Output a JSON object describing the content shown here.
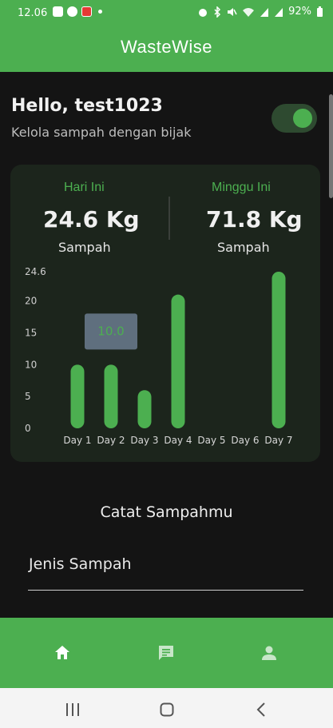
{
  "status_bar": {
    "time": "12.06",
    "battery": "92%",
    "left_icons": [
      "image-icon",
      "whatsapp-icon",
      "app-notification-icon",
      "dot-icon"
    ],
    "right_icons": [
      "alarm-icon",
      "bluetooth-icon",
      "mute-icon",
      "wifi-icon",
      "signal-icon",
      "signal-icon",
      "battery-icon"
    ]
  },
  "app_bar": {
    "title": "WasteWise"
  },
  "greeting": {
    "title": "Hello, test1023",
    "subtitle": "Kelola sampah dengan bijak",
    "theme_toggle_on": true
  },
  "stats": {
    "today": {
      "label": "Hari Ini",
      "value": "24.6 Kg",
      "unit": "Sampah"
    },
    "week": {
      "label": "Minggu Ini",
      "value": "71.8 Kg",
      "unit": "Sampah"
    }
  },
  "chart_data": {
    "type": "bar",
    "categories": [
      "Day 1",
      "Day 2",
      "Day 3",
      "Day 4",
      "Day 5",
      "Day 6",
      "Day 7"
    ],
    "values": [
      10,
      10,
      6,
      21,
      0,
      0,
      24.6
    ],
    "ylim": [
      0,
      24.6
    ],
    "yticks": [
      "0",
      "5",
      "10",
      "15",
      "20",
      "24.6"
    ],
    "tooltip": {
      "category": "Day 2",
      "value": "10.0"
    },
    "bar_color": "#4caf50",
    "grid": false
  },
  "form": {
    "section_title": "Catat Sampahmu",
    "waste_type_label": "Jenis Sampah"
  },
  "bottom_nav": {
    "items": [
      "home-icon",
      "message-icon",
      "profile-icon"
    ],
    "active": "home-icon"
  },
  "colors": {
    "accent": "#4caf50",
    "background": "#141414",
    "card": "#1c251c"
  }
}
